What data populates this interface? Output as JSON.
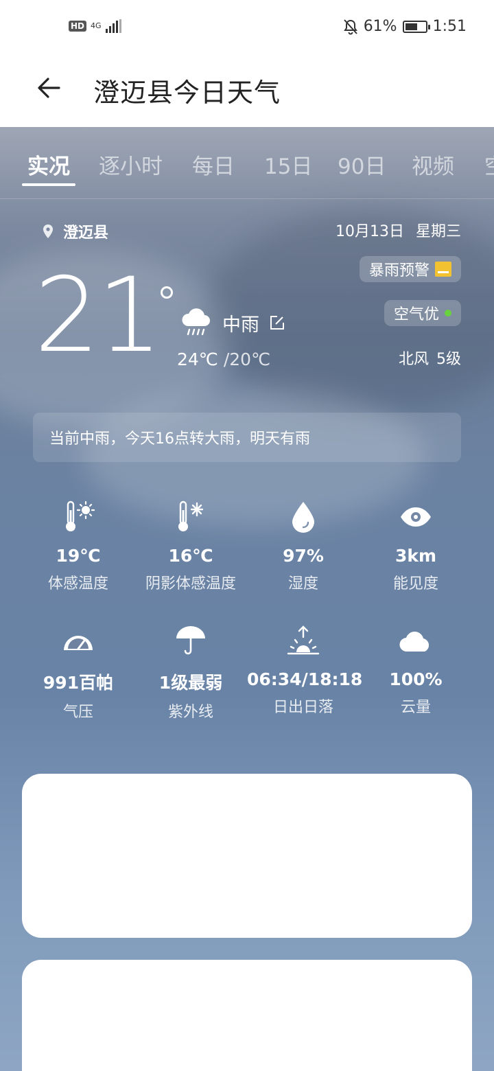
{
  "status": {
    "hd": "HD",
    "network": "4G",
    "battery_pct": "61%",
    "battery_level": 0.61,
    "time": "1:51",
    "icons": [
      "mute-bell-icon",
      "signal-icon",
      "battery-icon"
    ]
  },
  "header": {
    "title": "澄迈县今日天气",
    "back_icon": "arrow-left-icon"
  },
  "tabs": [
    {
      "label": "实况",
      "active": true
    },
    {
      "label": "逐小时"
    },
    {
      "label": "每日"
    },
    {
      "label": "15日"
    },
    {
      "label": "90日"
    },
    {
      "label": "视频"
    },
    {
      "label": "空"
    }
  ],
  "current": {
    "location": "澄迈县",
    "date": "10月13日 星期三",
    "warning": "暴雨预警",
    "air": "空气优",
    "temperature": "21",
    "condition": "中雨",
    "high": "24℃",
    "low": "/20℃",
    "wind": "北风 5级",
    "summary": "当前中雨，今天16点转大雨，明天有雨"
  },
  "details": [
    {
      "icon": "thermometer-sun-icon",
      "value": "19℃",
      "label": "体感温度"
    },
    {
      "icon": "thermometer-snow-icon",
      "value": "16℃",
      "label": "阴影体感温度"
    },
    {
      "icon": "droplet-icon",
      "value": "97%",
      "label": "湿度"
    },
    {
      "icon": "eye-icon",
      "value": "3km",
      "label": "能见度"
    },
    {
      "icon": "gauge-icon",
      "value": "991百帕",
      "label": "气压"
    },
    {
      "icon": "umbrella-icon",
      "value": "1级最弱",
      "label": "紫外线"
    },
    {
      "icon": "sunrise-icon",
      "value": "06:34/18:18",
      "label": "日出日落"
    },
    {
      "icon": "cloud-icon",
      "value": "100%",
      "label": "云量"
    }
  ],
  "colors": {
    "warning": "#f2c230",
    "air_good": "#68d140"
  }
}
